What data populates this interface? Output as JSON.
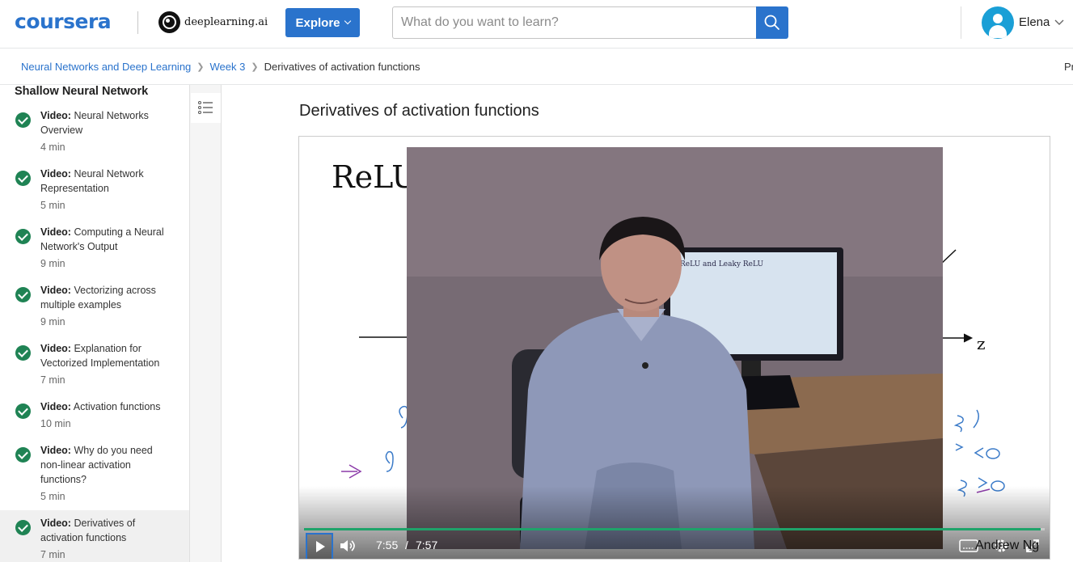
{
  "header": {
    "logo": "coursera",
    "partner": "deeplearning.ai",
    "explore_label": "Explore",
    "search_placeholder": "What do you want to learn?",
    "user_name": "Elena"
  },
  "breadcrumb": {
    "items": [
      "Neural Networks and Deep Learning",
      "Week 3"
    ],
    "current": "Derivatives of activation functions",
    "right_text": "Pr"
  },
  "sidebar": {
    "section_title": "Shallow Neural Network",
    "items": [
      {
        "kind": "Video:",
        "title": "Neural Networks Overview",
        "duration": "4 min"
      },
      {
        "kind": "Video:",
        "title": "Neural Network Representation",
        "duration": "5 min"
      },
      {
        "kind": "Video:",
        "title": "Computing a Neural Network's Output",
        "duration": "9 min"
      },
      {
        "kind": "Video:",
        "title": "Vectorizing across multiple examples",
        "duration": "9 min"
      },
      {
        "kind": "Video:",
        "title": "Explanation for Vectorized Implementation",
        "duration": "7 min"
      },
      {
        "kind": "Video:",
        "title": "Activation functions",
        "duration": "10 min"
      },
      {
        "kind": "Video:",
        "title": "Why do you need non-linear activation functions?",
        "duration": "5 min"
      },
      {
        "kind": "Video:",
        "title": "Derivatives of activation functions",
        "duration": "7 min"
      }
    ]
  },
  "main": {
    "lecture_title": "Derivatives of activation functions",
    "slide": {
      "title": "ReLU",
      "axis_label": "z",
      "watermark": "Andrew Ng",
      "monitor_title": "ReLU and Leaky ReLU"
    },
    "player": {
      "current_time": "7:55",
      "separator": "/",
      "duration": "7:57",
      "progress": 0.995
    }
  },
  "colors": {
    "brand_blue": "#2a73cc",
    "complete_green": "#1f8354",
    "progress_green": "#1fa36a"
  }
}
